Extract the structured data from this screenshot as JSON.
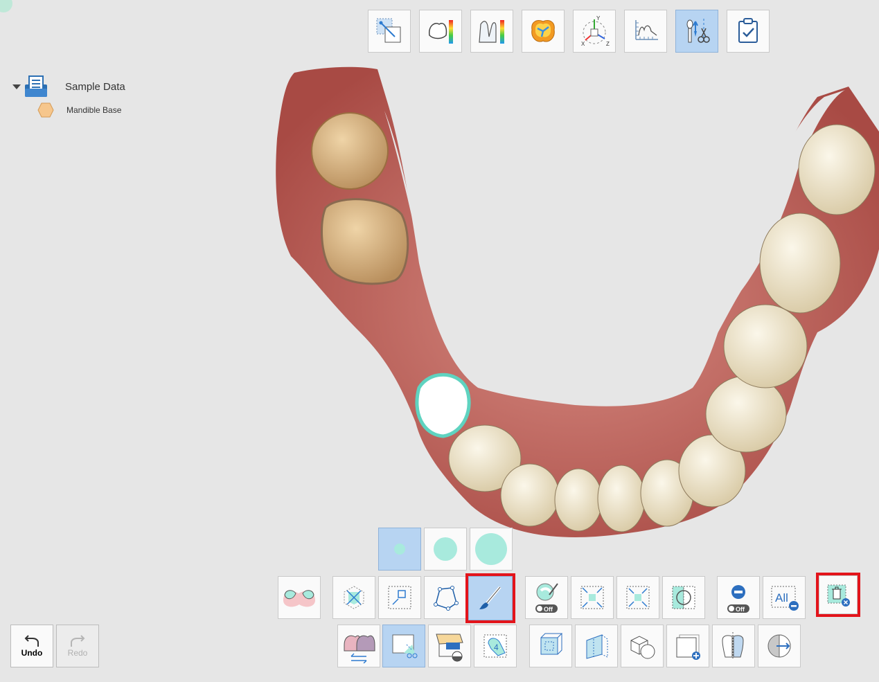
{
  "tree": {
    "root_label": "Sample Data",
    "child_label": "Mandible Base"
  },
  "top_toolbar": [
    {
      "name": "transform-tool-button",
      "icon": "transform-icon"
    },
    {
      "name": "thickness-map-button",
      "icon": "thickness-map-icon"
    },
    {
      "name": "deviation-map-button",
      "icon": "deviation-map-icon"
    },
    {
      "name": "occlusion-button",
      "icon": "occlusion-icon"
    },
    {
      "name": "axis-view-button",
      "icon": "axis-icon"
    },
    {
      "name": "measure-button",
      "icon": "ruler-icon"
    },
    {
      "name": "edit-trim-button",
      "icon": "scissors-icon",
      "active": true
    },
    {
      "name": "complete-button",
      "icon": "checklist-icon"
    }
  ],
  "axis_labels": {
    "x": "X",
    "y": "Y",
    "z": "Z"
  },
  "brush_sizes": [
    "small",
    "medium",
    "large"
  ],
  "bottom_toolbar": {
    "invert_all_label": "All",
    "toggle_off_label": "Off"
  },
  "undo": {
    "label": "Undo"
  },
  "redo": {
    "label": "Redo"
  },
  "colors": {
    "accent": "#a8eadd",
    "active_bg": "#b7d4f2",
    "highlight": "#e3141b"
  }
}
